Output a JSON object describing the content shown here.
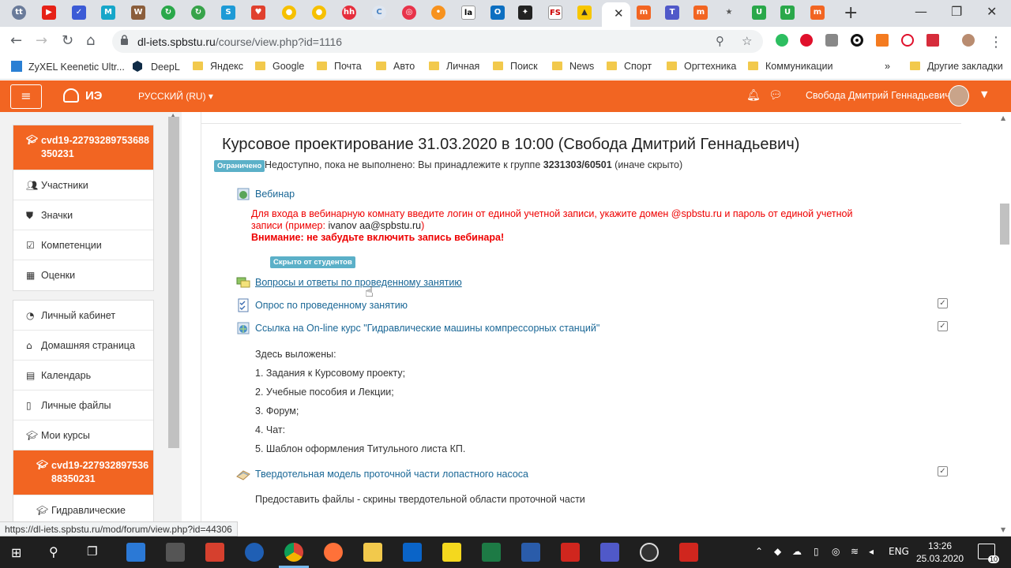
{
  "browser": {
    "url_domain": "dl-iets.spbstu.ru",
    "url_path": "/course/view.php?id=1116",
    "bookmarks": [
      "ZyXEL Keenetic Ultr...",
      "DeepL",
      "Яндекс",
      "Google",
      "Почта",
      "Авто",
      "Личная",
      "Поиск",
      "News",
      "Спорт",
      "Оргтехника",
      "Коммуникации",
      "»",
      "Другие закладки"
    ]
  },
  "header": {
    "logo": "ИЭ",
    "language": "РУССКИЙ (RU) ▾",
    "user_name": "Свобода Дмитрий Геннадьевич"
  },
  "drawer": {
    "course_short": "cvd19-22793289753688350231",
    "course_items": [
      {
        "label": "Участники",
        "icon": "users-icon"
      },
      {
        "label": "Значки",
        "icon": "shield-icon"
      },
      {
        "label": "Компетенции",
        "icon": "check-square-icon"
      },
      {
        "label": "Оценки",
        "icon": "table-icon"
      }
    ],
    "site_items": [
      {
        "label": "Личный кабинет",
        "icon": "dashboard-icon"
      },
      {
        "label": "Домашняя страница",
        "icon": "home-icon"
      },
      {
        "label": "Календарь",
        "icon": "calendar-icon"
      },
      {
        "label": "Личные файлы",
        "icon": "file-icon"
      },
      {
        "label": "Мои курсы",
        "icon": "graduation-cap-icon"
      }
    ],
    "my_course_active": "cvd19-22793289753688350231",
    "my_course_next": "Гидравлические"
  },
  "section": {
    "title": "Курсовое проектирование 31.03.2020 в 10:00 (Свобода Дмитрий Геннадьевич)",
    "restricted_badge": "Ограничено",
    "restriction_prefix": "Недоступно, пока не выполнено: Вы принадлежите к группе",
    "restriction_group": "3231303/60501",
    "restriction_suffix": "(иначе скрыто)",
    "webinar_label": "Вебинар",
    "webinar_text_1": "Для входа в вебинарную комнату введите логин от единой учетной записи, укажите домен @spbstu.ru и пароль от единой учетной",
    "webinar_text_2a": "записи (пример:",
    "webinar_text_2b": "ivanov  aa@spbstu.ru",
    "webinar_text_2c": ")",
    "webinar_warning": "Внимание: не забудьте включить запись вебинара!",
    "hidden_badge": "Скрыто от студентов",
    "forum_label": "Вопросы и ответы по проведенному занятию",
    "quiz_label": "Опрос по проведенному занятию",
    "link_label": "Ссылка на On-line курс \"Гидравлические машины компрессорных станций\"",
    "description": [
      "Здесь выложены:",
      "1. Задания к Курсовому проекту;",
      "2. Учебные пособия и Лекции;",
      "3. Форум;",
      "4. Чат:",
      "5. Шаблон оформления Титульного листа КП."
    ],
    "assign_label": "Твердотельная модель проточной части лопастного насоса",
    "assign_desc": "Предоставить файлы - скрины твердотельной области проточной части"
  },
  "status_url": "https://dl-iets.spbstu.ru/mod/forum/view.php?id=44306",
  "taskbar": {
    "lang": "ENG",
    "time": "13:26",
    "date": "25.03.2020",
    "notifications": "10"
  },
  "colors": {
    "brand_orange": "#f26522",
    "link_blue": "#1a6796",
    "badge_blue": "#5bb0c8",
    "alert_red": "#ee0000"
  }
}
